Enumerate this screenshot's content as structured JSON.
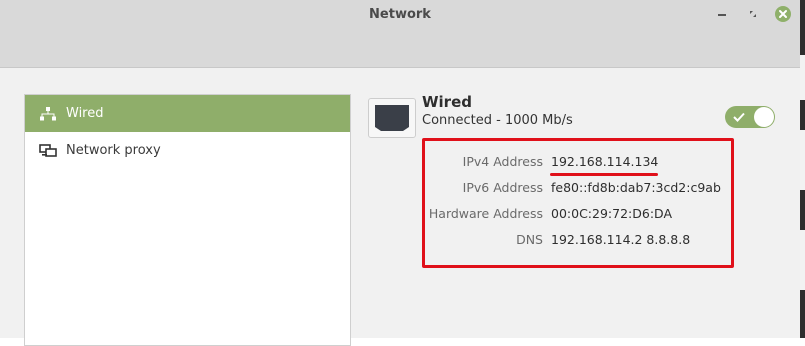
{
  "window": {
    "title": "Network"
  },
  "sidebar": {
    "items": [
      {
        "label": "Wired",
        "icon": "wired-network-icon",
        "active": true
      },
      {
        "label": "Network proxy",
        "icon": "network-proxy-icon",
        "active": false
      }
    ]
  },
  "wired": {
    "title": "Wired",
    "status": "Connected - 1000 Mb/s",
    "enabled": true,
    "details": [
      {
        "label": "IPv4 Address",
        "value": "192.168.114.134"
      },
      {
        "label": "IPv6 Address",
        "value": "fe80::fd8b:dab7:3cd2:c9ab"
      },
      {
        "label": "Hardware Address",
        "value": "00:0C:29:72:D6:DA"
      },
      {
        "label": "DNS",
        "value": "192.168.114.2 8.8.8.8"
      }
    ]
  },
  "colors": {
    "accent": "#8fae6a",
    "highlight": "#e0101a"
  }
}
